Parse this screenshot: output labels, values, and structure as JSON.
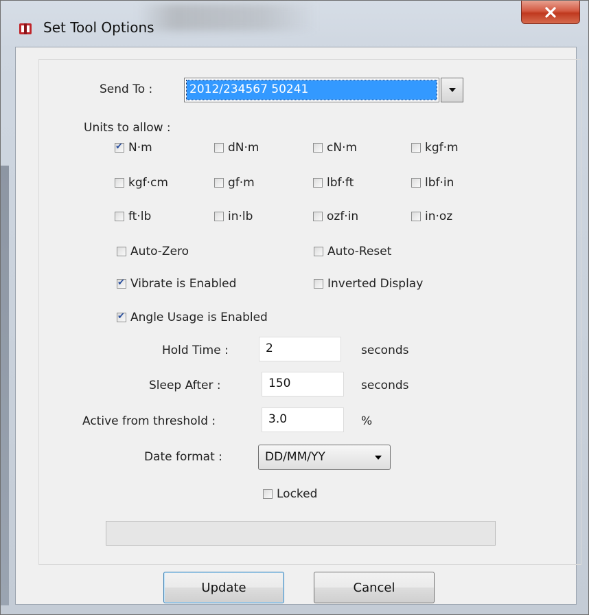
{
  "window": {
    "title": "Set Tool Options"
  },
  "send_to": {
    "label": "Send To :",
    "value": "2012/234567   50241"
  },
  "units": {
    "label": "Units to allow :",
    "items": [
      {
        "label": "N·m",
        "checked": true
      },
      {
        "label": "dN·m",
        "checked": false
      },
      {
        "label": "cN·m",
        "checked": false
      },
      {
        "label": "kgf·m",
        "checked": false
      },
      {
        "label": "kgf·cm",
        "checked": false
      },
      {
        "label": "gf·m",
        "checked": false
      },
      {
        "label": "lbf·ft",
        "checked": false
      },
      {
        "label": "lbf·in",
        "checked": false
      },
      {
        "label": "ft·lb",
        "checked": false
      },
      {
        "label": "in·lb",
        "checked": false
      },
      {
        "label": "ozf·in",
        "checked": false
      },
      {
        "label": "in·oz",
        "checked": false
      }
    ]
  },
  "options": [
    {
      "label": "Auto-Zero",
      "checked": false
    },
    {
      "label": "Auto-Reset",
      "checked": false
    },
    {
      "label": "Vibrate is Enabled",
      "checked": true
    },
    {
      "label": "Inverted Display",
      "checked": false
    },
    {
      "label": "Angle Usage is Enabled",
      "checked": true
    }
  ],
  "hold_time": {
    "label": "Hold Time :",
    "value": "2",
    "unit": "seconds"
  },
  "sleep_after": {
    "label": "Sleep After :",
    "value": "150",
    "unit": "seconds"
  },
  "threshold": {
    "label": "Active from threshold :",
    "value": "3.0",
    "unit": "%"
  },
  "date_format": {
    "label": "Date format :",
    "value": "DD/MM/YY"
  },
  "locked": {
    "label": "Locked",
    "checked": false
  },
  "buttons": {
    "update": "Update",
    "cancel": "Cancel"
  }
}
